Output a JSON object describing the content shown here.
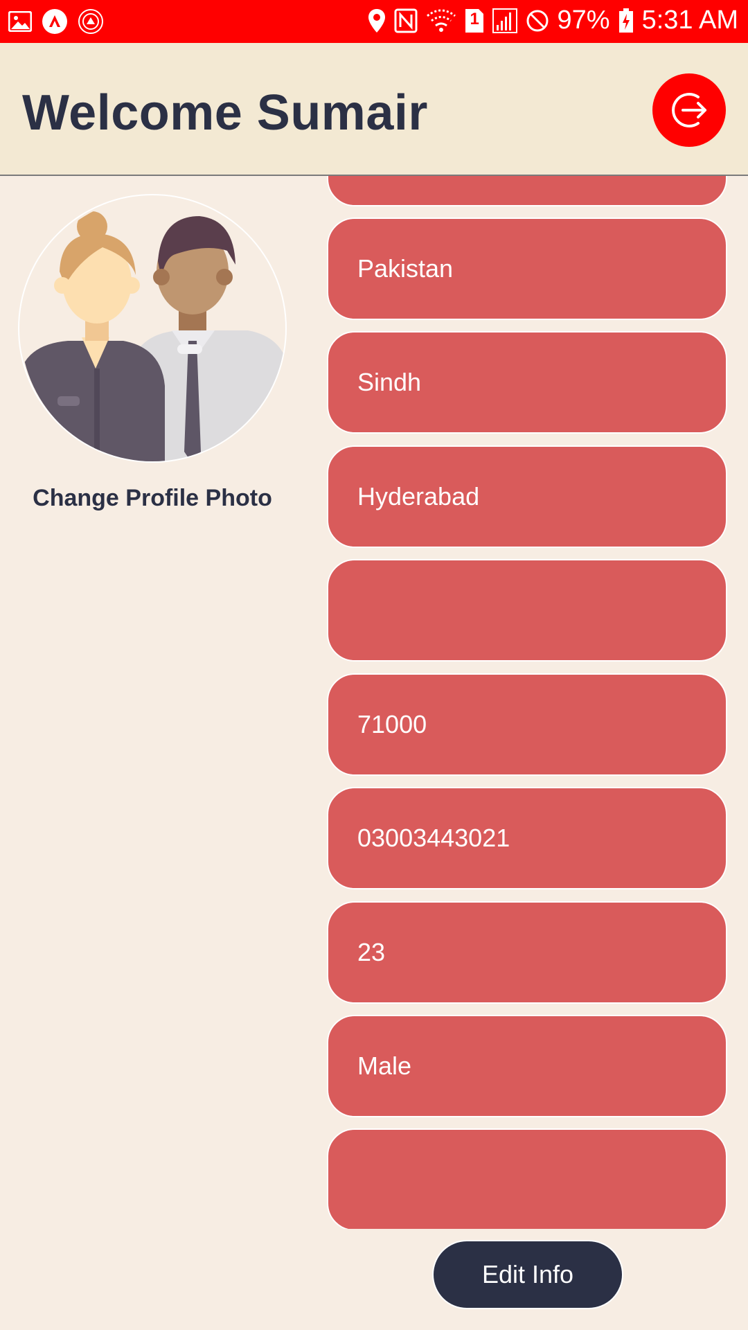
{
  "status_bar": {
    "battery": "97%",
    "time": "5:31 AM",
    "sim_slot": "1"
  },
  "header": {
    "title": "Welcome Sumair"
  },
  "profile": {
    "change_photo_label": "Change Profile Photo"
  },
  "fields": [
    {
      "value": ""
    },
    {
      "value": "Pakistan"
    },
    {
      "value": "Sindh"
    },
    {
      "value": "Hyderabad"
    },
    {
      "value": ""
    },
    {
      "value": "71000"
    },
    {
      "value": "03003443021"
    },
    {
      "value": "23"
    },
    {
      "value": "Male"
    },
    {
      "value": ""
    }
  ],
  "actions": {
    "edit_label": "Edit Info"
  },
  "colors": {
    "status_bar": "#ff0000",
    "header_bg": "#f3e9d3",
    "page_bg": "#f7ede3",
    "field_bg": "#d95b5b",
    "title_text": "#2b3045",
    "edit_button_bg": "#2b3045",
    "logout_button_bg": "#ff0000"
  }
}
